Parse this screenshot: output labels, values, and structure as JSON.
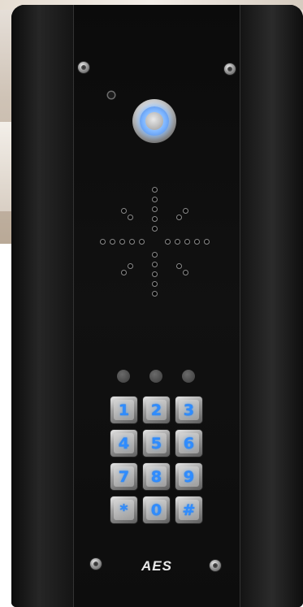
{
  "logo": {
    "text": "AES"
  },
  "keypad": {
    "keys": [
      "1",
      "2",
      "3",
      "4",
      "5",
      "6",
      "7",
      "8",
      "9",
      "*",
      "0",
      "#"
    ]
  },
  "colors": {
    "panel": "#121212",
    "key_glow": "#2f8cff",
    "call_ring": "#7bb4ff"
  },
  "icons": {
    "speaker": "speaker-grille-icon",
    "call": "call-button-icon",
    "microphone": "microphone-icon"
  }
}
